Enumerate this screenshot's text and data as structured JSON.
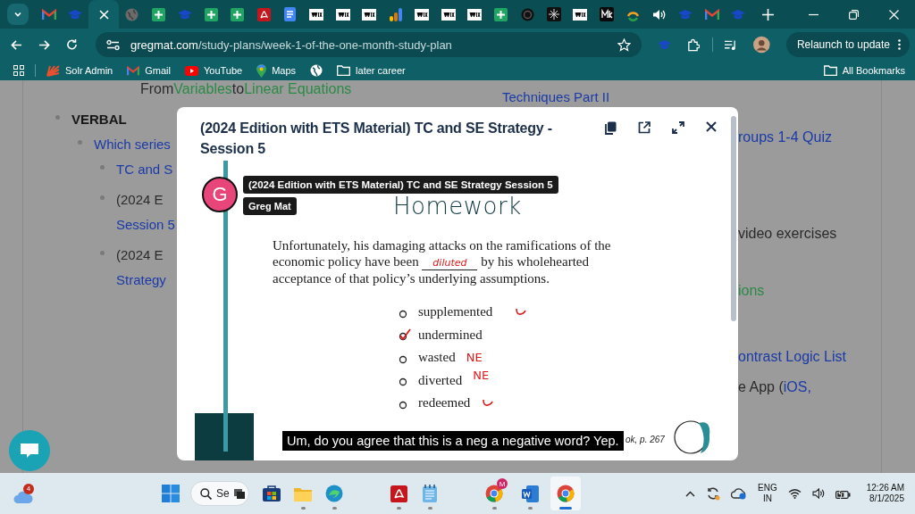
{
  "browser": {
    "tabs": [
      {
        "kind": "mail",
        "selected": false
      },
      {
        "kind": "cap",
        "selected": false
      },
      {
        "selected": true
      },
      {
        "kind": "globe",
        "selected": false
      },
      {
        "kind": "sheet",
        "selected": false
      },
      {
        "kind": "cap",
        "selected": false
      },
      {
        "kind": "sheet",
        "selected": false
      },
      {
        "kind": "sheet",
        "selected": false
      },
      {
        "kind": "pdf",
        "selected": false
      },
      {
        "kind": "doc",
        "selected": false
      },
      {
        "kind": "wix",
        "selected": false
      },
      {
        "kind": "wix",
        "selected": false
      },
      {
        "kind": "wix",
        "selected": false
      },
      {
        "kind": "chart",
        "selected": false
      },
      {
        "kind": "wix",
        "selected": false
      },
      {
        "kind": "wix",
        "selected": false
      },
      {
        "kind": "wix",
        "selected": false
      },
      {
        "kind": "sheet",
        "selected": false
      },
      {
        "kind": "dark",
        "selected": false
      },
      {
        "kind": "pattern",
        "selected": false
      },
      {
        "kind": "wix",
        "selected": false
      },
      {
        "kind": "mk",
        "selected": false
      },
      {
        "kind": "ring",
        "selected": false
      },
      {
        "kind": "audio",
        "selected": false
      },
      {
        "kind": "cap",
        "selected": false
      },
      {
        "kind": "mail",
        "selected": false
      },
      {
        "kind": "cap",
        "selected": false
      }
    ],
    "url_host": "gregmat.com",
    "url_path": "/study-plans/week-1-of-the-one-month-study-plan",
    "relaunch_button": "Relaunch to update",
    "bookmarks": [
      {
        "kind": "solr",
        "label": "Solr Admin"
      },
      {
        "kind": "mail",
        "label": "Gmail"
      },
      {
        "kind": "youtube",
        "label": "YouTube"
      },
      {
        "kind": "maps",
        "label": "Maps"
      },
      {
        "kind": "globe"
      },
      {
        "kind": "folder",
        "label": "later career"
      }
    ],
    "all_bookmarks": "All Bookmarks"
  },
  "page": {
    "fragment": [
      {
        "text": "From",
        "kind": "plain"
      },
      {
        "text": "Variables",
        "kind": "green"
      },
      {
        "text": "to",
        "kind": "plain"
      },
      {
        "text": "Linear Equations",
        "kind": "green"
      }
    ],
    "outline": [
      {
        "lines": [
          {
            "text": "VERBAL",
            "kind": "heading"
          }
        ],
        "children": [
          {
            "lines": [
              {
                "text": "Which series",
                "kind": "link"
              }
            ],
            "children": [
              {
                "lines": [
                  {
                    "text": "TC and S",
                    "kind": "link"
                  }
                ]
              },
              {
                "lines": [
                  {
                    "text": "(2024 E",
                    "kind": "plain"
                  },
                  {
                    "text": "Session 5",
                    "kind": "link"
                  }
                ]
              },
              {
                "lines": [
                  {
                    "text": "(2024 E",
                    "kind": "plain"
                  },
                  {
                    "text": "Strategy",
                    "kind": "link"
                  }
                ]
              }
            ]
          }
        ]
      }
    ],
    "right_lines": [
      [
        {
          "text": "Techniques Part II",
          "kind": "link"
        }
      ],
      [
        {
          "text": "roups 1-4 Quiz",
          "kind": "link"
        }
      ],
      [
        {
          "text": "video exercises",
          "kind": "plain"
        }
      ],
      [
        {
          "text": "ions",
          "kind": "green"
        }
      ],
      [
        {
          "text": "ontrast Logic List",
          "kind": "link"
        }
      ],
      [
        {
          "text": "e App (",
          "kind": "plain"
        },
        {
          "text": "iOS,",
          "kind": "link"
        }
      ]
    ]
  },
  "modal": {
    "title": "(2024 Edition with ETS Material) TC and SE Strategy - Session 5",
    "video": {
      "overlay_title": "(2024 Edition with ETS Material) TC and SE Strategy Session 5",
      "channel": "Greg Mat",
      "avatar_letter": "G",
      "heading": "Homework",
      "question": {
        "before": "Unfortunately, his damaging attacks on the ramifications of the economic policy have been",
        "blank": "diluted",
        "after": "by his wholehearted acceptance of that policy’s underlying assumptions."
      },
      "choices": [
        {
          "label": "supplemented",
          "selected": false,
          "annotation": {
            "kind": "curve"
          }
        },
        {
          "label": "undermined",
          "selected": true
        },
        {
          "label": "wasted",
          "selected": false,
          "annotation": {
            "kind": "text",
            "text": "NE"
          }
        },
        {
          "label": "diverted",
          "selected": false,
          "annotation": {
            "kind": "text",
            "text": "NE"
          }
        },
        {
          "label": "redeemed",
          "selected": false,
          "annotation": {
            "kind": "curve"
          }
        }
      ],
      "caption": "Um, do you agree that this is a neg a negative word? Yep.",
      "source": "ok, p. 267"
    }
  },
  "taskbar": {
    "weather_badge": "4",
    "search_placeholder": "Se",
    "apps": [
      {
        "kind": "store",
        "open": false,
        "selected": false
      },
      {
        "kind": "files",
        "open": true,
        "selected": false
      },
      {
        "kind": "edge",
        "open": true,
        "selected": false
      },
      {
        "kind": "pdf",
        "open": true,
        "selected": false
      },
      {
        "kind": "notepad",
        "open": true,
        "selected": false
      },
      {
        "kind": "chrome",
        "badge": "M",
        "open": true,
        "selected": false
      },
      {
        "kind": "word",
        "open": true,
        "selected": false
      },
      {
        "kind": "chrome",
        "open": true,
        "selected": true
      }
    ],
    "language": "ENG",
    "region": "IN",
    "time": "12:26 AM",
    "date": "8/1/2025"
  }
}
